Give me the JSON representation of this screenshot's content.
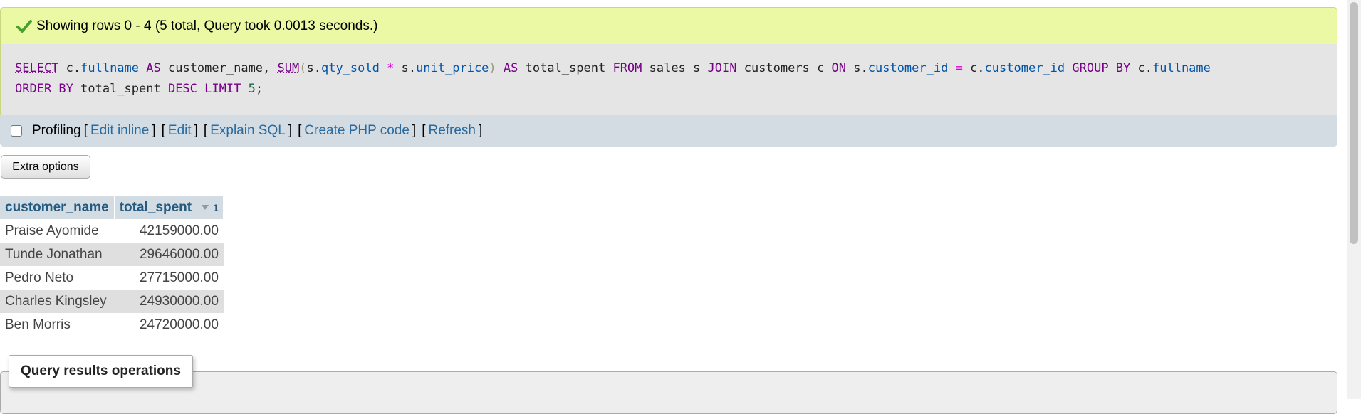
{
  "success": {
    "message": "Showing rows 0 - 4 (5 total, Query took 0.0013 seconds.)",
    "icon": "check-icon"
  },
  "sql": {
    "kw_select": "SELECT",
    "t1": " c.",
    "c_fullname": "fullname",
    "kw_as1": " AS ",
    "t2": "customer_name, ",
    "fn_sum": "SUM",
    "br_open": "(",
    "t3": "s.",
    "c_qty": "qty_sold",
    "op_mul": " * ",
    "t4": "s.",
    "c_price": "unit_price",
    "br_close": ")",
    "kw_as2": " AS ",
    "t5": "total_spent ",
    "kw_from": "FROM",
    "t6": " sales s ",
    "kw_join": "JOIN",
    "t7": " customers c ",
    "kw_on": "ON",
    "t8": " s.",
    "c_cid1": "customer_id",
    "op_eq": " = ",
    "t9": "c.",
    "c_cid2": "customer_id",
    "t10": " ",
    "kw_group": "GROUP BY",
    "t11": " c.",
    "c_fullname2": "fullname",
    "t12": "\n",
    "kw_order": "ORDER BY",
    "t13": " total_spent ",
    "kw_desc": "DESC",
    "t14": " ",
    "kw_limit": "LIMIT",
    "t15": " ",
    "num_5": "5",
    "t16": ";"
  },
  "toolbar": {
    "profiling_label": "Profiling",
    "lb": "[",
    "rb": "]",
    "edit_inline": "Edit inline",
    "edit": "Edit",
    "explain_sql": "Explain SQL",
    "create_php": "Create PHP code",
    "refresh": "Refresh"
  },
  "extra_options_label": "Extra options",
  "table": {
    "headers": [
      "customer_name",
      "total_spent"
    ],
    "sort_order": "1",
    "rows": [
      [
        "Praise Ayomide",
        "42159000.00"
      ],
      [
        "Tunde Jonathan",
        "29646000.00"
      ],
      [
        "Pedro Neto",
        "27715000.00"
      ],
      [
        "Charles Kingsley",
        "24930000.00"
      ],
      [
        "Ben Morris",
        "24720000.00"
      ]
    ]
  },
  "operations": {
    "legend": "Query results operations"
  },
  "colors": {
    "success_bg": "#ebf8a4",
    "link": "#2b6a9c",
    "header_bg": "#d3dce3",
    "keyword": "#770088"
  }
}
